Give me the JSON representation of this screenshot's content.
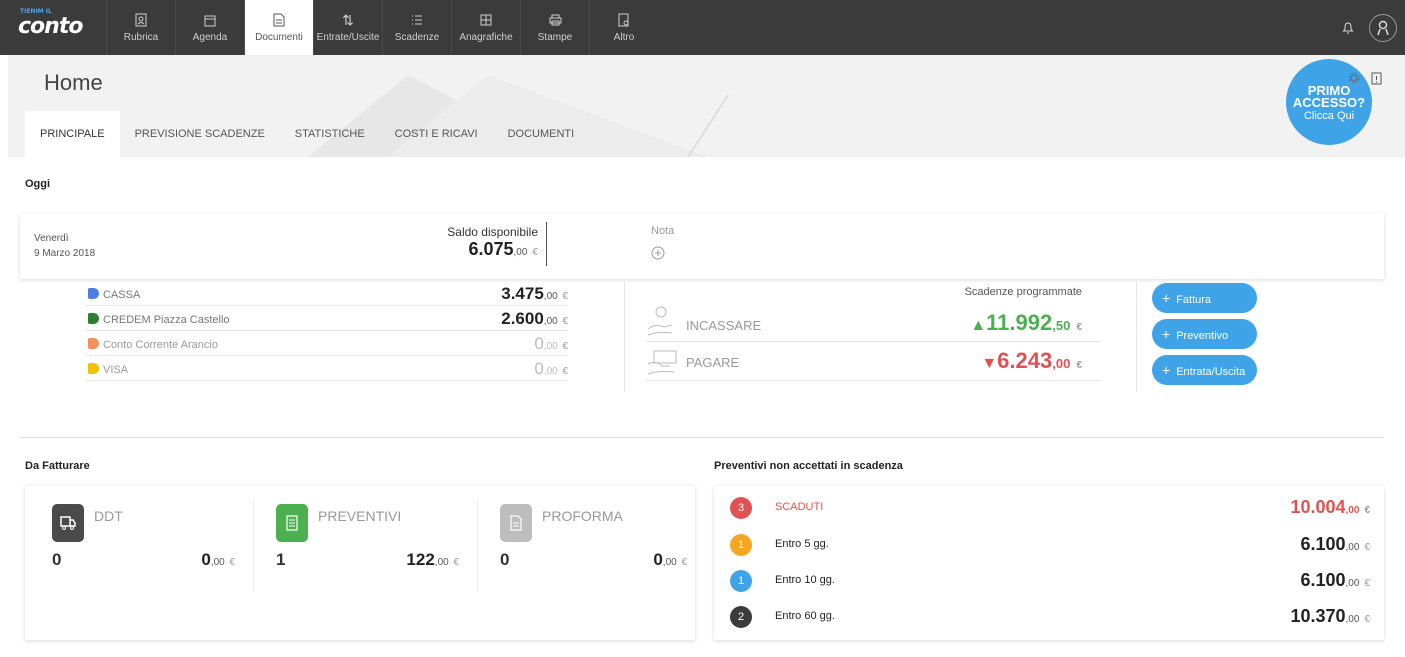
{
  "app": {
    "logo_small": "TIENIM IL",
    "logo": "conto"
  },
  "nav": [
    {
      "label": "Rubrica",
      "icon": "contact-card-icon"
    },
    {
      "label": "Agenda",
      "icon": "calendar-icon"
    },
    {
      "label": "Documenti",
      "icon": "document-icon"
    },
    {
      "label": "Entrate/Uscite",
      "icon": "arrows-up-down-icon"
    },
    {
      "label": "Scadenze",
      "icon": "list-check-icon"
    },
    {
      "label": "Anagrafiche",
      "icon": "grid-icon"
    },
    {
      "label": "Stampe",
      "icon": "printer-icon"
    },
    {
      "label": "Altro",
      "icon": "more-doc-icon"
    }
  ],
  "nav_active": "Documenti",
  "page": {
    "title": "Home"
  },
  "tabs": [
    "PRINCIPALE",
    "PREVISIONE SCADENZE",
    "STATISTICHE",
    "COSTI E RICAVI",
    "DOCUMENTI"
  ],
  "primo": {
    "line1": "PRIMO",
    "line2": "ACCESSO?",
    "line3": "Clicca Qui"
  },
  "oggi": {
    "title": "Oggi",
    "day": "Venerdì",
    "date": "9 Marzo 2018",
    "saldo_label": "Saldo disponibile",
    "saldo_int": "6.075",
    "saldo_cents": ",00",
    "currency": "€",
    "nota_label": "Nota"
  },
  "accounts": [
    {
      "name": "CASSA",
      "color": "#4a7fe0",
      "int": "3.475",
      "cents": ",00",
      "dim": false
    },
    {
      "name": "CREDEM Piazza Castello",
      "color": "#2e7d32",
      "int": "2.600",
      "cents": ",00",
      "dim": false
    },
    {
      "name": "Conto Corrente Arancio",
      "color": "#f0905a",
      "int": "0",
      "cents": ",00",
      "dim": true
    },
    {
      "name": "VISA",
      "color": "#f2c200",
      "int": "0",
      "cents": ",00",
      "dim": true
    }
  ],
  "scadenze": {
    "title": "Scadenze programmate",
    "incassare_label": "INCASSARE",
    "incassare_int": "11.992",
    "incassare_cents": ",50",
    "pagare_label": "PAGARE",
    "pagare_int": "6.243",
    "pagare_cents": ",00"
  },
  "actions": [
    "Fattura",
    "Preventivo",
    "Entrata/Uscita"
  ],
  "fatturare": {
    "title": "Da Fatturare",
    "items": [
      {
        "label": "DDT",
        "count": "0",
        "int": "0",
        "cents": ",00",
        "color": "#4a4a4a",
        "icon": "truck-icon"
      },
      {
        "label": "PREVENTIVI",
        "count": "1",
        "int": "122",
        "cents": ",00",
        "color": "#4caf50",
        "icon": "quote-list-icon"
      },
      {
        "label": "PROFORMA",
        "count": "0",
        "int": "0",
        "cents": ",00",
        "color": "#bdbdbd",
        "icon": "proforma-doc-icon"
      }
    ]
  },
  "preventivi": {
    "title": "Preventivi non accettati in scadenza",
    "rows": [
      {
        "count": "3",
        "label": "SCADUTI",
        "int": "10.004",
        "cents": ",00",
        "color": "#e05252",
        "red": true
      },
      {
        "count": "1",
        "label": "Entro 5 gg.",
        "int": "6.100",
        "cents": ",00",
        "color": "#f5a623",
        "red": false
      },
      {
        "count": "1",
        "label": "Entro 10 gg.",
        "int": "6.100",
        "cents": ",00",
        "color": "#3fa3e8",
        "red": false
      },
      {
        "count": "2",
        "label": "Entro 60 gg.",
        "int": "10.370",
        "cents": ",00",
        "color": "#3b3b3b",
        "red": false
      }
    ]
  },
  "colors": {
    "accent": "#3fa3e8",
    "green": "#4caf50",
    "red": "#e05252",
    "topbar": "#3b3b3b"
  }
}
